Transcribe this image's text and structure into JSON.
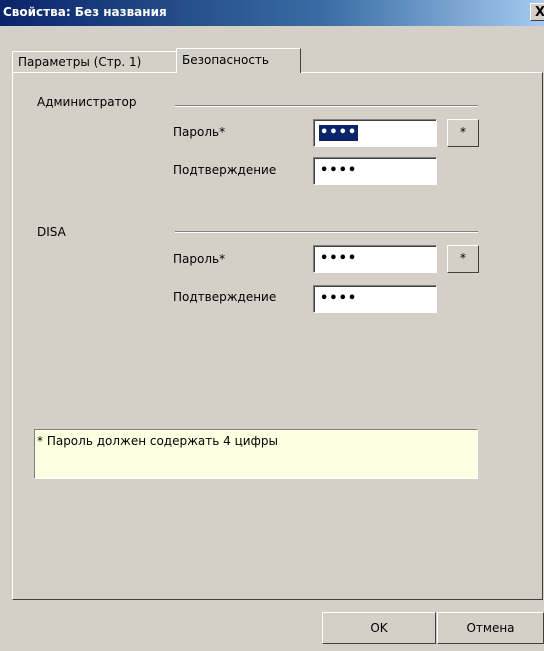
{
  "window": {
    "title": "Свойства: Без названия",
    "close_glyph": "X"
  },
  "tabs": [
    {
      "label": "Параметры (Стр. 1)",
      "active": false
    },
    {
      "label": "Безопасность",
      "active": true
    }
  ],
  "admin": {
    "group_label": "Администратор",
    "password_label": "Пароль*",
    "password_value": "••••",
    "confirm_label": "Подтверждение",
    "confirm_value": "••••",
    "star_label": "*"
  },
  "disa": {
    "group_label": "DISA",
    "password_label": "Пароль*",
    "password_value": "••••",
    "confirm_label": "Подтверждение",
    "confirm_value": "••••",
    "star_label": "*"
  },
  "note": "* Пароль должен содержать 4 цифры",
  "buttons": {
    "ok": "OK",
    "cancel": "Отмена"
  },
  "colors": {
    "face": "#d4d0c8",
    "selection": "#0a246a",
    "note_bg": "#ffffe1"
  }
}
